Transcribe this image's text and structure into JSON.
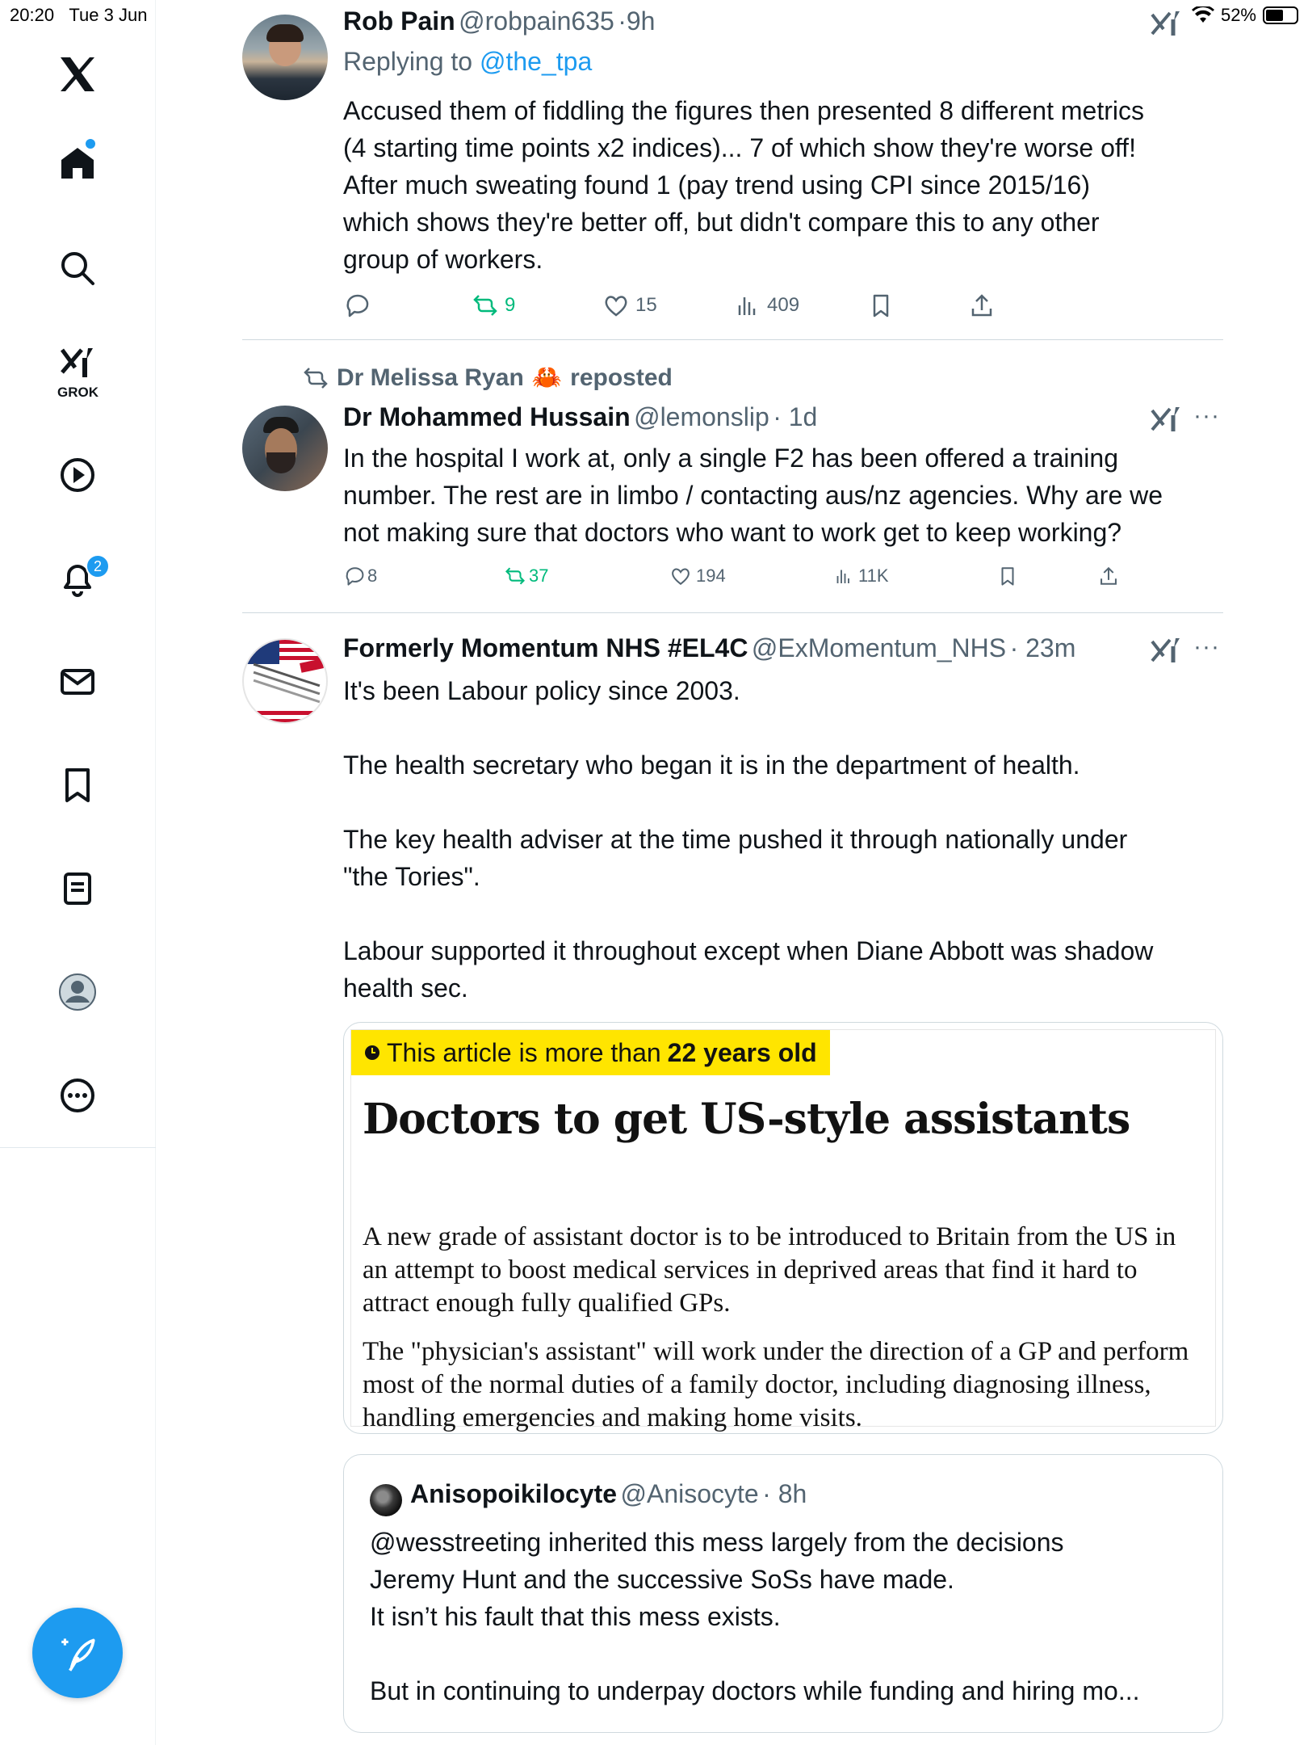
{
  "status_bar": {
    "time": "20:20",
    "date": "Tue 3 Jun",
    "battery": "52%"
  },
  "sidebar": {
    "grok_label": "GROK",
    "notifications_count": "2",
    "items": [
      "x-logo-icon",
      "home-icon",
      "search-icon",
      "grok-icon",
      "video-icon",
      "notifications-icon",
      "messages-icon",
      "bookmarks-icon",
      "lists-icon",
      "profile-icon",
      "more-icon"
    ]
  },
  "tweets": [
    {
      "name": "Rob Pain",
      "handle": "@robpain635",
      "time": "9h",
      "replying_prefix": "Replying to",
      "replying_to": "@the_tpa",
      "lines": [
        "Accused them of fiddling the figures then presented 8 different metrics",
        "(4 starting time points x2 indices)... 7 of which show they're worse off!",
        "After much sweating  found 1 (pay trend using CPI since 2015/16)",
        "which shows they're better off, but didn't compare this to any other",
        "group of workers."
      ],
      "stats": {
        "replies": "",
        "reposts": "9",
        "likes": "15",
        "views": "409"
      }
    },
    {
      "repost_by": "Dr Melissa Ryan",
      "repost_emoji": "🦀",
      "repost_label": "reposted",
      "name": "Dr Mohammed Hussain",
      "handle": "@lemonslip",
      "time": "· 1d",
      "lines": [
        "In the hospital I work at, only a single F2 has been offered a training",
        "number. The rest are in limbo / contacting aus/nz agencies. Why are we",
        "not making sure that doctors who want to work get to keep working?"
      ],
      "stats": {
        "replies": "8",
        "reposts": "37",
        "likes": "194",
        "views": "11K"
      }
    },
    {
      "name": "Formerly Momentum NHS #EL4C",
      "handle": "@ExMomentum_NHS",
      "time": "· 23m",
      "lines": [
        "It's been Labour policy since 2003.",
        "",
        "The health secretary who began it is in the department of health.",
        "",
        "The key health adviser at the time pushed it through nationally under",
        "\"the Tories\".",
        "",
        "Labour supported it throughout except when Diane Abbott was shadow",
        "health sec."
      ],
      "article": {
        "banner_prefix": "This article is more than",
        "banner_bold": "22 years old",
        "title": "Doctors to get US-style assistants",
        "paragraph1": "A new grade of assistant doctor is to be introduced to Britain from the US in an attempt to boost medical services in deprived areas that find it hard to attract enough fully qualified GPs.",
        "paragraph2": "The \"physician's assistant\" will work under the direction of a GP and perform most of the normal duties of a family doctor, including diagnosing illness, handling emergencies and making home visits."
      },
      "quote": {
        "name": "Anisopoikilocyte",
        "handle": "@Anisocyte",
        "time": "· 8h",
        "lines": [
          "@wesstreeting inherited this mess largely from the decisions",
          "Jeremy Hunt and the successive SoSs have made.",
          "It isn’t his fault that this mess exists.",
          "",
          "But in continuing to underpay doctors while funding and hiring mo..."
        ]
      }
    }
  ],
  "colors": {
    "accent": "#1d9bf0",
    "repost_green": "#00ba7c",
    "muted": "#536471",
    "banner_yellow": "#ffe500"
  }
}
